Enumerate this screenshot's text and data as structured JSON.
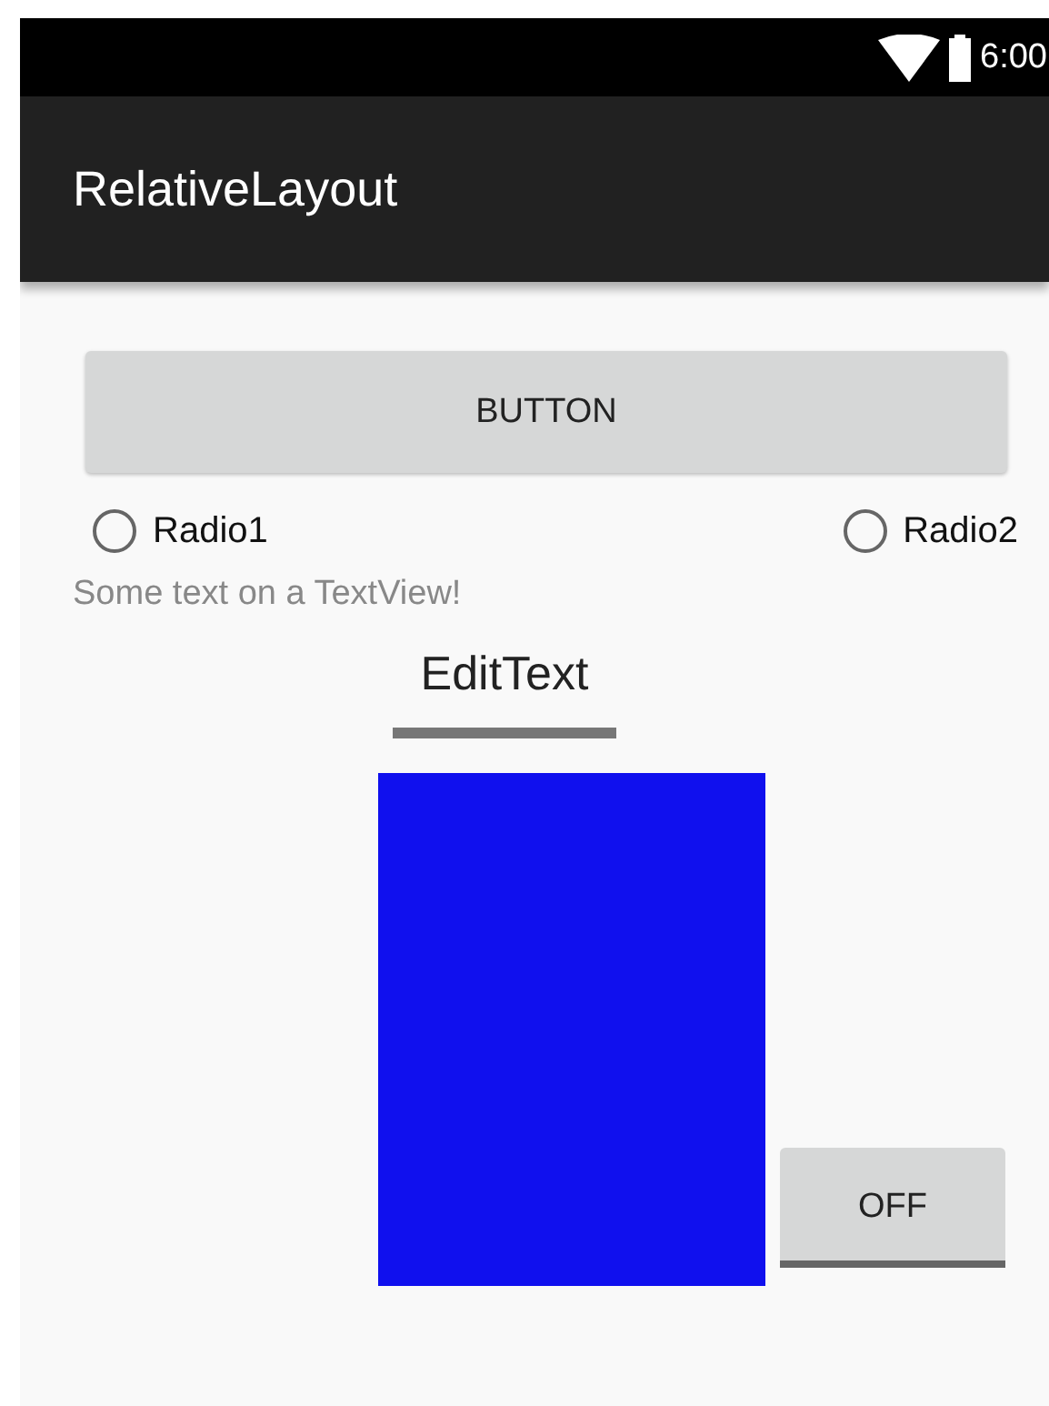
{
  "status_bar": {
    "time": "6:00"
  },
  "app_bar": {
    "title": "RelativeLayout"
  },
  "button": {
    "label": "BUTTON"
  },
  "radios": [
    {
      "label": "Radio1",
      "selected": false
    },
    {
      "label": "Radio2",
      "selected": false
    }
  ],
  "text_view": "Some text on a TextView!",
  "edit_text": {
    "value": "EditText"
  },
  "toggle": {
    "label": "OFF",
    "checked": false
  }
}
